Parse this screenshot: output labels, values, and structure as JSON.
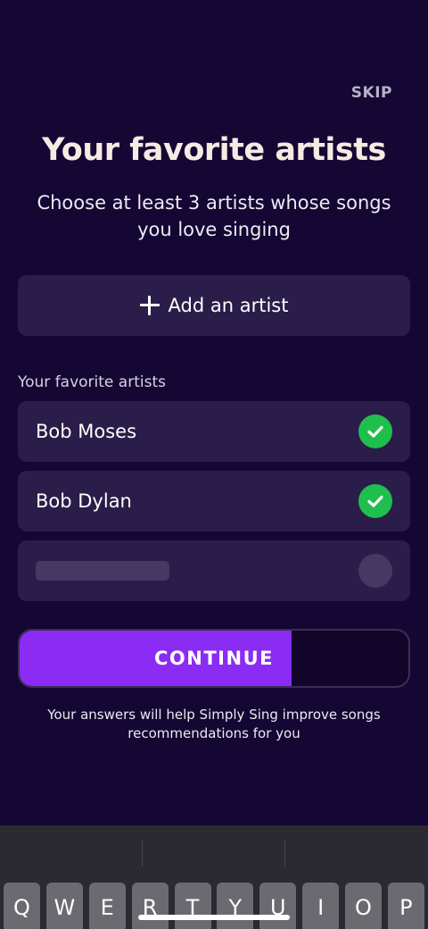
{
  "header": {
    "skip_label": "SKIP"
  },
  "onboarding": {
    "title": "Your favorite artists",
    "subtitle": "Choose at least 3 artists whose songs you love singing"
  },
  "add_artist": {
    "label": "Add an artist",
    "icon": "plus-icon"
  },
  "favorites": {
    "section_label": "Your favorite artists",
    "artists": [
      {
        "name": "Bob Moses",
        "selected": true,
        "icon": "check-circle-icon"
      },
      {
        "name": "Bob Dylan",
        "selected": true,
        "icon": "check-circle-icon"
      }
    ],
    "empty_slots": 1
  },
  "continue_button": {
    "label": "CONTINUE",
    "progress": 0.7
  },
  "footnote": "Your answers will help Simply Sing improve songs recommendations for you",
  "keyboard": {
    "keys": [
      "Q",
      "W",
      "E",
      "R",
      "T",
      "Y",
      "U",
      "I",
      "O",
      "P"
    ]
  },
  "colors": {
    "background": "#140733",
    "card": "#2a1d4a",
    "accent": "#8a2cf4",
    "check": "#1fbf4d",
    "title": "#f6ebe2"
  }
}
